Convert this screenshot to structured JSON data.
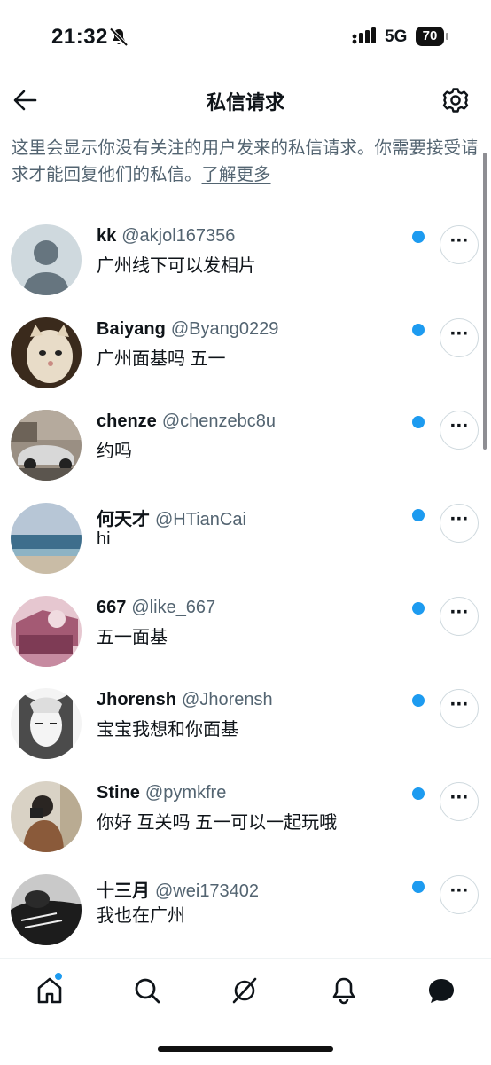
{
  "status_bar": {
    "time": "21:32",
    "network": "5G",
    "battery": "70"
  },
  "header": {
    "title": "私信请求",
    "back_icon": "arrow-left-icon",
    "settings_icon": "gear-icon"
  },
  "description": {
    "text": "这里会显示你没有关注的用户发来的私信请求。你需要接受请求才能回复他们的私信。",
    "link": "了解更多"
  },
  "requests": [
    {
      "name": "kk",
      "handle": "@akjol167356",
      "message": "广州线下可以发相片",
      "unread": true,
      "avatar": "default"
    },
    {
      "name": "Baiyang",
      "handle": "@Byang0229",
      "message": "广州面基吗 五一",
      "unread": true,
      "avatar": "cat"
    },
    {
      "name": "chenze",
      "handle": "@chenzebc8u",
      "message": "约吗",
      "unread": true,
      "avatar": "car"
    },
    {
      "name": "何天才",
      "handle": "@HTianCai",
      "message": "hi",
      "unread": true,
      "avatar": "sea"
    },
    {
      "name": "667",
      "handle": "@like_667",
      "message": "五一面基",
      "unread": true,
      "avatar": "pink"
    },
    {
      "name": "Jhorensh",
      "handle": "@Jhorensh",
      "message": "宝宝我想和你面基",
      "unread": true,
      "avatar": "sketch"
    },
    {
      "name": "Stine",
      "handle": "@pymkfre",
      "message": "你好 互关吗 五一可以一起玩哦",
      "unread": true,
      "avatar": "person"
    },
    {
      "name": "十三月",
      "handle": "@wei173402",
      "message": "我也在广州",
      "unread": true,
      "avatar": "dark"
    }
  ],
  "tabbar": [
    "home-icon",
    "search-icon",
    "grok-icon",
    "bell-icon",
    "messages-icon"
  ],
  "colors": {
    "accent": "#1d9bf0",
    "secondary_text": "#536471",
    "primary_text": "#0f1419"
  }
}
